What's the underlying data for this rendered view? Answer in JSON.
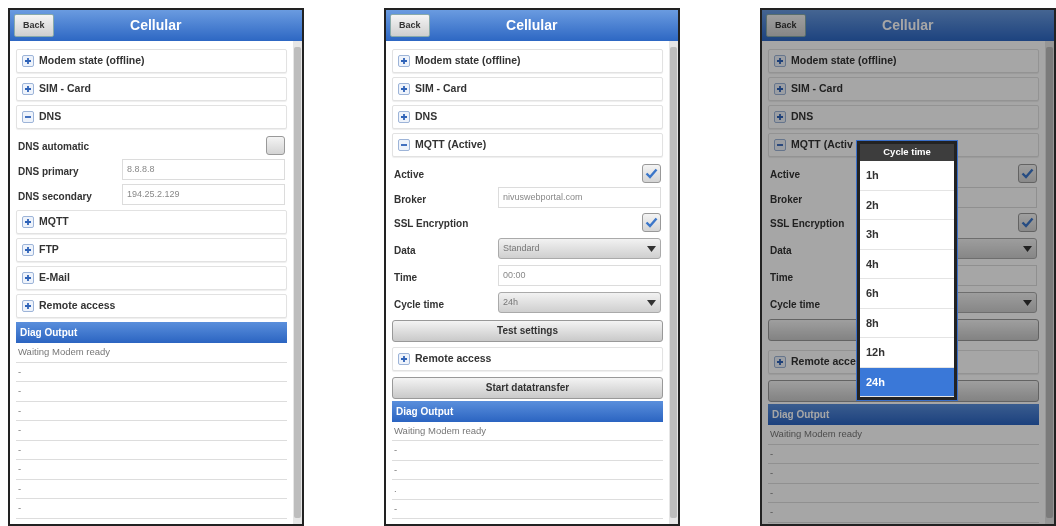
{
  "screens": [
    {
      "back": "Back",
      "title": "Cellular",
      "dimmed": false,
      "items": [
        {
          "kind": "section",
          "label": "Modem state (offline)",
          "expanded": false
        },
        {
          "kind": "section",
          "label": "SIM - Card",
          "expanded": false
        },
        {
          "kind": "section",
          "label": "DNS",
          "expanded": true,
          "fields": [
            {
              "kind": "checkbox",
              "label": "DNS automatic",
              "checked": false
            },
            {
              "kind": "text",
              "label": "DNS primary",
              "value": "8.8.8.8"
            },
            {
              "kind": "text",
              "label": "DNS secondary",
              "value": "194.25.2.129"
            }
          ]
        },
        {
          "kind": "section",
          "label": "MQTT",
          "expanded": false
        },
        {
          "kind": "section",
          "label": "FTP",
          "expanded": false
        },
        {
          "kind": "section",
          "label": "E-Mail",
          "expanded": false
        },
        {
          "kind": "section",
          "label": "Remote access",
          "expanded": false
        }
      ],
      "diag": {
        "title": "Diag Output",
        "lines": [
          "Waiting Modem ready",
          "-",
          "-",
          "-",
          "-",
          "-",
          "-",
          "-",
          "-"
        ]
      }
    },
    {
      "back": "Back",
      "title": "Cellular",
      "dimmed": false,
      "items": [
        {
          "kind": "section",
          "label": "Modem state (offline)",
          "expanded": false
        },
        {
          "kind": "section",
          "label": "SIM - Card",
          "expanded": false
        },
        {
          "kind": "section",
          "label": "DNS",
          "expanded": false
        },
        {
          "kind": "section",
          "label": "MQTT (Active)",
          "expanded": true,
          "fields": [
            {
              "kind": "checkbox",
              "label": "Active",
              "checked": true
            },
            {
              "kind": "text",
              "label": "Broker",
              "value": "nivuswebportal.com"
            },
            {
              "kind": "checkbox",
              "label": "SSL Encryption",
              "checked": true
            },
            {
              "kind": "select",
              "label": "Data",
              "value": "Standard"
            },
            {
              "kind": "text",
              "label": "Time",
              "value": "00:00"
            },
            {
              "kind": "select",
              "label": "Cycle time",
              "value": "24h"
            },
            {
              "kind": "button",
              "label": "Test settings"
            }
          ]
        },
        {
          "kind": "section",
          "label": "Remote access",
          "expanded": false
        },
        {
          "kind": "button",
          "label": "Start datatransfer"
        }
      ],
      "diag": {
        "title": "Diag Output",
        "lines": [
          "Waiting Modem ready",
          "-",
          "-",
          ".",
          "-"
        ]
      }
    },
    {
      "back": "Back",
      "title": "Cellular",
      "dimmed": true,
      "items": [
        {
          "kind": "section",
          "label": "Modem state (offline)",
          "expanded": false
        },
        {
          "kind": "section",
          "label": "SIM - Card",
          "expanded": false
        },
        {
          "kind": "section",
          "label": "DNS",
          "expanded": false
        },
        {
          "kind": "section",
          "label": "MQTT (Activ",
          "expanded": true,
          "fields": [
            {
              "kind": "checkbox",
              "label": "Active",
              "checked": true
            },
            {
              "kind": "text",
              "label": "Broker"
            },
            {
              "kind": "checkbox",
              "label": "SSL Encryption",
              "checked": true
            },
            {
              "kind": "select",
              "label": "Data"
            },
            {
              "kind": "text",
              "label": "Time"
            },
            {
              "kind": "select",
              "label": "Cycle time"
            },
            {
              "kind": "button"
            }
          ]
        },
        {
          "kind": "section",
          "label": "Remote acce",
          "expanded": false
        },
        {
          "kind": "button"
        }
      ],
      "diag": {
        "title": "Diag Output",
        "lines": [
          "Waiting Modem ready",
          "-",
          "-",
          "-",
          "-"
        ]
      },
      "popup": {
        "title": "Cycle time",
        "options": [
          {
            "label": "1h",
            "selected": false
          },
          {
            "label": "2h",
            "selected": false
          },
          {
            "label": "3h",
            "selected": false
          },
          {
            "label": "4h",
            "selected": false
          },
          {
            "label": "6h",
            "selected": false
          },
          {
            "label": "8h",
            "selected": false
          },
          {
            "label": "12h",
            "selected": false
          },
          {
            "label": "24h",
            "selected": true
          }
        ]
      }
    }
  ]
}
